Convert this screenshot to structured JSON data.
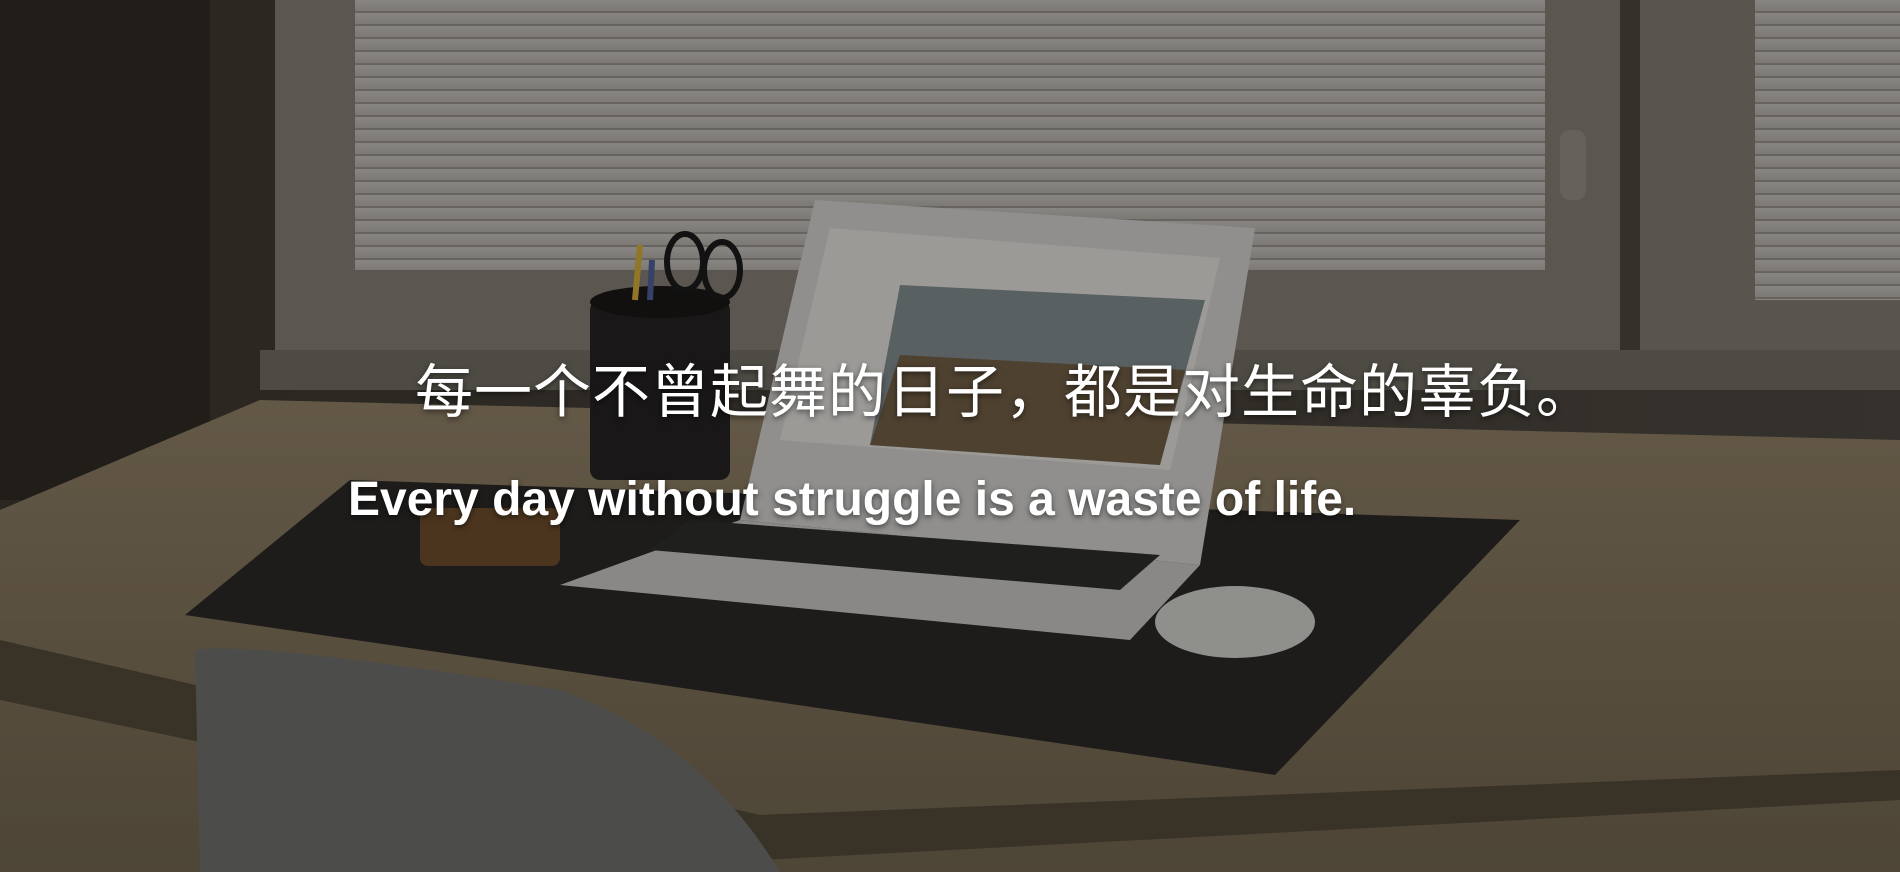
{
  "quote": {
    "chinese": "每一个不曾起舞的日子，都是对生命的辜负。",
    "english": "Every day without struggle is a waste of life."
  },
  "colors": {
    "text": "#ffffff",
    "overlay": "rgba(0,0,0,0.28)"
  }
}
